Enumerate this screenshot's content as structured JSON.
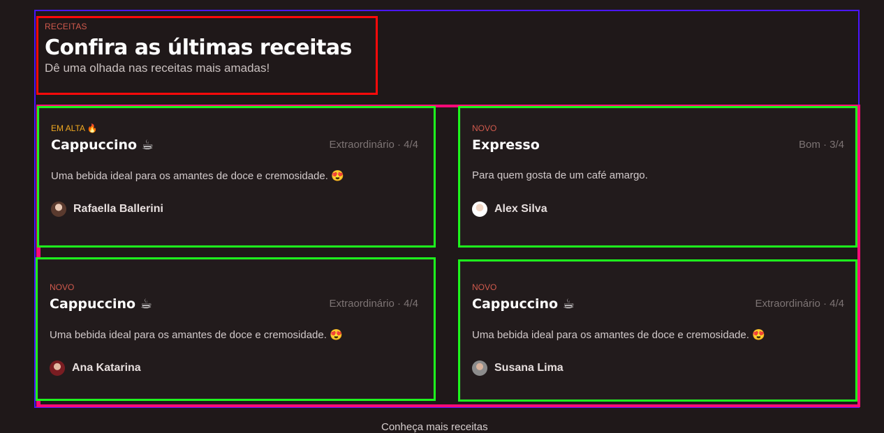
{
  "section": {
    "eyebrow": "RECEITAS",
    "title": "Confira as últimas receitas",
    "subtitle": "Dê uma olhada nas receitas mais amadas!"
  },
  "cards": [
    {
      "tag": "EM ALTA 🔥",
      "title": "Cappuccino ☕",
      "rating": "Extraordinário · 4/4",
      "description": "Uma bebida ideal para os amantes de doce e cremosidade. 😍",
      "author": "Rafaella Ballerini"
    },
    {
      "tag": "NOVO",
      "title": "Expresso",
      "rating": "Bom · 3/4",
      "description": "Para quem gosta de um café amargo.",
      "author": "Alex Silva"
    },
    {
      "tag": "NOVO",
      "title": "Cappuccino ☕",
      "rating": "Extraordinário · 4/4",
      "description": "Uma bebida ideal para os amantes de doce e cremosidade. 😍",
      "author": "Ana Katarina"
    },
    {
      "tag": "NOVO",
      "title": "Cappuccino ☕",
      "rating": "Extraordinário · 4/4",
      "description": "Uma bebida ideal para os amantes de doce e cremosidade. 😍",
      "author": "Susana Lima"
    }
  ],
  "footer": {
    "hint": "Conheça mais receitas"
  },
  "colors": {
    "background": "#1f1819",
    "accent_tag": "#d15a4d",
    "hot_tag": "#f0a820",
    "card_border_highlight": "#1df51d",
    "grid_border_highlight": "#ff0a78",
    "header_border_highlight": "#ff0a0a",
    "outer_border_highlight": "#4a16ff"
  }
}
